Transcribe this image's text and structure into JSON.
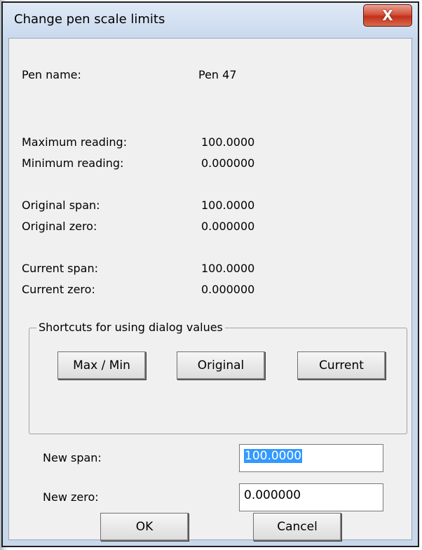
{
  "window": {
    "title": "Change pen scale limits",
    "close_glyph": "X"
  },
  "info": {
    "pen_name_label": "Pen name:",
    "pen_name_value": "Pen 47",
    "max_reading_label": "Maximum reading:",
    "max_reading_value": "100.0000",
    "min_reading_label": "Minimum reading:",
    "min_reading_value": "0.000000",
    "orig_span_label": "Original span:",
    "orig_span_value": "100.0000",
    "orig_zero_label": "Original zero:",
    "orig_zero_value": "0.000000",
    "cur_span_label": "Current span:",
    "cur_span_value": "100.0000",
    "cur_zero_label": "Current zero:",
    "cur_zero_value": "0.000000"
  },
  "shortcuts": {
    "legend": "Shortcuts for using dialog values",
    "maxmin_label": "Max / Min",
    "original_label": "Original",
    "current_label": "Current"
  },
  "inputs": {
    "new_span_label": "New span:",
    "new_span_value": "100.0000",
    "new_zero_label": "New zero:",
    "new_zero_value": "0.000000"
  },
  "actions": {
    "ok_label": "OK",
    "cancel_label": "Cancel"
  },
  "colors": {
    "selection": "#3399ff",
    "dialog_face": "#f0f0f0",
    "close_button": "#c2301a"
  },
  "icons": {
    "close": "close-icon"
  }
}
